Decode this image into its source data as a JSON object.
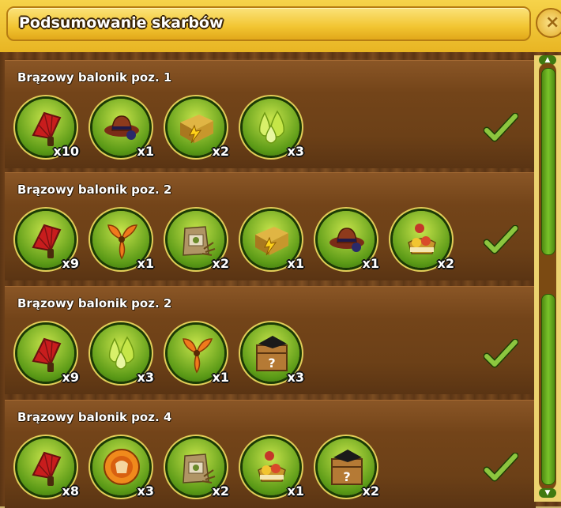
{
  "window": {
    "title": "Podsumowanie skarbów",
    "close_label": "×"
  },
  "rows": [
    {
      "title": "Brązowy balonik poz. 1",
      "items": [
        {
          "icon": "fan-icon",
          "count": "x10"
        },
        {
          "icon": "cowboy-hat-icon",
          "count": "x1"
        },
        {
          "icon": "hay-bale-icon",
          "count": "x2"
        },
        {
          "icon": "fertilizer-drops-icon",
          "count": "x3"
        }
      ],
      "completed": true
    },
    {
      "title": "Brązowy balonik poz. 2",
      "items": [
        {
          "icon": "fan-icon",
          "count": "x9"
        },
        {
          "icon": "propeller-icon",
          "count": "x1"
        },
        {
          "icon": "seed-bag-icon",
          "count": "x2"
        },
        {
          "icon": "hay-bale-icon",
          "count": "x1"
        },
        {
          "icon": "cowboy-hat-icon",
          "count": "x1"
        },
        {
          "icon": "gift-basket-icon",
          "count": "x2"
        }
      ],
      "completed": true
    },
    {
      "title": "Brązowy balonik poz. 2",
      "items": [
        {
          "icon": "fan-icon",
          "count": "x9"
        },
        {
          "icon": "fertilizer-drops-icon",
          "count": "x3"
        },
        {
          "icon": "propeller-icon",
          "count": "x1"
        },
        {
          "icon": "mystery-crate-icon",
          "count": "x3"
        }
      ],
      "completed": true
    },
    {
      "title": "Brązowy balonik poz. 4",
      "items": [
        {
          "icon": "fan-icon",
          "count": "x8"
        },
        {
          "icon": "orange-token-icon",
          "count": "x3"
        },
        {
          "icon": "seed-bag-icon",
          "count": "x2"
        },
        {
          "icon": "gift-basket-icon",
          "count": "x1"
        },
        {
          "icon": "mystery-crate-icon",
          "count": "x2"
        }
      ],
      "completed": true
    }
  ],
  "colors": {
    "gold": "#f2c531",
    "wood": "#6e411a",
    "green": "#5b9a17",
    "check": "#8cc63f"
  }
}
